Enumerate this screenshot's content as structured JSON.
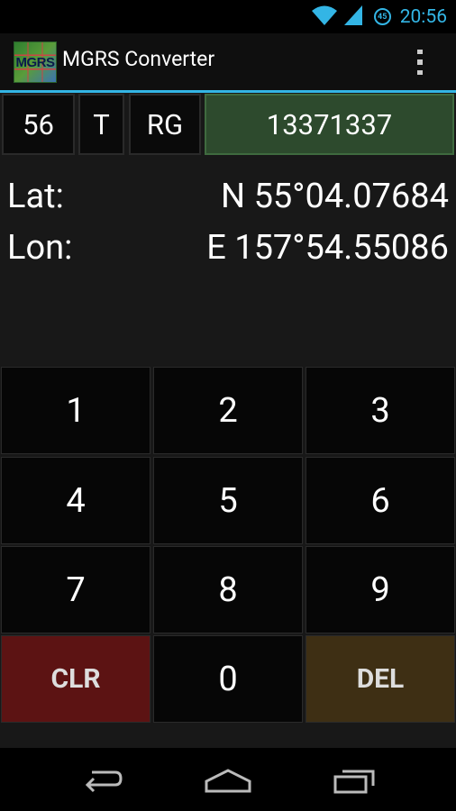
{
  "status_bar": {
    "notification_count": "45",
    "time": "20:56",
    "icons": [
      "wifi-icon",
      "signal-icon"
    ]
  },
  "action_bar": {
    "app_icon_text": "MGRS",
    "title": "MGRS Converter",
    "overflow_icon": "overflow-menu-icon"
  },
  "mgrs_fields": {
    "zone": "56",
    "band": "T",
    "square": "RG",
    "easting_northing": "13371337"
  },
  "coordinates": {
    "lat_label": "Lat:",
    "lat_value": "N 55°04.07684",
    "lon_label": "Lon:",
    "lon_value": "E 157°54.55086"
  },
  "keypad": {
    "k1": "1",
    "k2": "2",
    "k3": "3",
    "k4": "4",
    "k5": "5",
    "k6": "6",
    "k7": "7",
    "k8": "8",
    "k9": "9",
    "clr": "CLR",
    "k0": "0",
    "del": "DEL"
  },
  "nav_bar": {
    "icons": [
      "back-icon",
      "home-icon",
      "recent-apps-icon"
    ]
  },
  "colors": {
    "accent": "#33b5e5",
    "easting_field": "#2d4a2d",
    "clr_key": "#5c1313",
    "del_key": "#3e2f14"
  }
}
